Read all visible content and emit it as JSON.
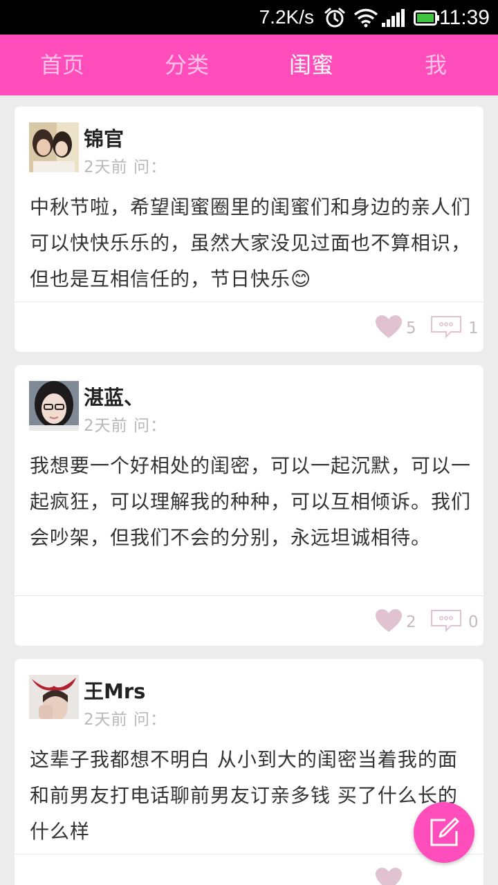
{
  "status_bar": {
    "speed": "7.2K/s",
    "time": "11:39",
    "icons": [
      "alarm-icon",
      "wifi-icon",
      "signal-icon",
      "battery-icon"
    ]
  },
  "nav": {
    "tabs": [
      {
        "label": "首页",
        "active": false
      },
      {
        "label": "分类",
        "active": false
      },
      {
        "label": "闺蜜",
        "active": true
      },
      {
        "label": "我",
        "active": false
      }
    ]
  },
  "posts": [
    {
      "username": "锦官",
      "meta": "2天前 问：",
      "text": "中秋节啦，希望闺蜜圈里的闺蜜们和身边的亲人们可以快快乐乐的，虽然大家没见过面也不算相识，但也是互相信任的，节日快乐😊",
      "likes": "5",
      "comments": "1"
    },
    {
      "username": "湛蓝、",
      "meta": "2天前 问：",
      "text": "我想要一个好相处的闺密，可以一起沉默，可以一起疯狂，可以理解我的种种，可以互相倾诉。我们会吵架，但我们不会的分别，永远坦诚相待。",
      "likes": "2",
      "comments": "0"
    },
    {
      "username": "王Mrs",
      "meta": "2天前 问：",
      "text": "这辈子我都想不明白 从小到大的闺密当着我的面 和前男友打电话聊前男友订亲多钱 买了什么长的什么样"
    }
  ],
  "colors": {
    "accent": "#ff4dbb",
    "tab_inactive": "#ffc2e4",
    "icon": "#e0c2d0"
  },
  "fab_icon": "edit-icon"
}
